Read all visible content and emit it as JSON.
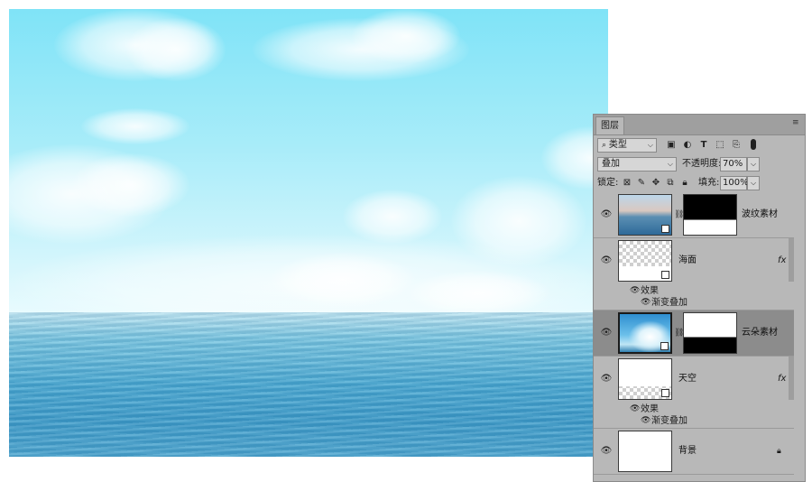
{
  "panel": {
    "tab_label": "图层",
    "filter": {
      "kind": "类型"
    },
    "blend_mode": "叠加",
    "opacity_label": "不透明度:",
    "opacity_value": "70%",
    "lock_label": "锁定:",
    "fill_label": "填充:",
    "fill_value": "100%",
    "icons": [
      "image-filter-icon",
      "adjustment-filter-icon",
      "type-filter-icon",
      "shape-filter-icon",
      "smart-object-filter-icon",
      "filter-toggle-icon",
      "lock-transparent-icon",
      "lock-paint-icon",
      "lock-move-icon",
      "lock-artboard-icon",
      "lock-all-icon"
    ]
  },
  "layers": [
    {
      "name": "波纹素材",
      "thumbnail": "sea-photo",
      "mask": "black-top-white-bottom",
      "visible": true,
      "selected": false
    },
    {
      "name": "海面",
      "thumbnail": "transparent-white-bottom",
      "fx": "fx",
      "visible": true,
      "selected": false,
      "effects_label": "效果",
      "effect": "渐变叠加"
    },
    {
      "name": "云朵素材",
      "thumbnail": "cloud-photo",
      "mask": "white-top-black-bottom",
      "visible": true,
      "selected": true
    },
    {
      "name": "天空",
      "thumbnail": "white-top-transparent-bottom",
      "fx": "fx",
      "visible": true,
      "selected": false,
      "effects_label": "效果",
      "effect": "渐变叠加"
    },
    {
      "name": "背景",
      "thumbnail": "white",
      "locked": true,
      "visible": true,
      "selected": false
    }
  ],
  "colors": {
    "panel_bg": "#b8b8b8",
    "selected_layer": "#8c8c8c",
    "sky_top": "#7fe3f7",
    "sea": "#3f9dca"
  }
}
